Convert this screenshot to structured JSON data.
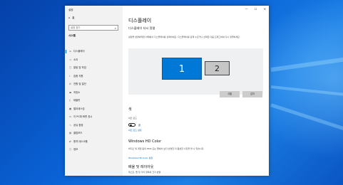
{
  "colors": {
    "accent": "#0078d7",
    "desktop": "#0a63d6",
    "link": "#0067b8"
  },
  "window": {
    "app_title": "설정",
    "controls": [
      "—",
      "☐",
      "✕"
    ],
    "home_label": "홈",
    "search_placeholder": "설정 찾기",
    "section": "시스템",
    "nav": [
      {
        "label": "디스플레이",
        "icon": "monitor-icon",
        "glyph": "▭",
        "active": true
      },
      {
        "label": "소리",
        "icon": "speaker-icon",
        "glyph": "◁"
      },
      {
        "label": "알림 및 작업",
        "icon": "notification-icon",
        "glyph": "▢"
      },
      {
        "label": "집중 지원",
        "icon": "moon-icon",
        "glyph": "☾"
      },
      {
        "label": "전원 및 절전",
        "icon": "power-icon",
        "glyph": "⏻"
      },
      {
        "label": "저장소",
        "icon": "storage-icon",
        "glyph": "▬"
      },
      {
        "label": "태블릿",
        "icon": "tablet-icon",
        "glyph": "▯"
      },
      {
        "label": "멀티태스킹",
        "icon": "multitask-icon",
        "glyph": "▦"
      },
      {
        "label": "이 PC에 화면 표시",
        "icon": "project-icon",
        "glyph": "▭"
      },
      {
        "label": "공유 환경",
        "icon": "share-icon",
        "glyph": "⤳"
      },
      {
        "label": "클립보드",
        "icon": "clipboard-icon",
        "glyph": "▤"
      },
      {
        "label": "원격 데스크톱",
        "icon": "remote-icon",
        "glyph": "⇄"
      },
      {
        "label": "정보",
        "icon": "info-icon",
        "glyph": "ⓘ"
      }
    ]
  },
  "content": {
    "title": "디스플레이",
    "subhead": "디스플레이 다시 정렬",
    "description": "설정을 변경하려면 아래에서 디스플레이를 선택하세요. 디스플레이를 길게 누르거나 선택한 다음 드래그하여 다시 정렬하세요.",
    "monitors": [
      "1",
      "2"
    ],
    "identify_button": "식별",
    "detect_button": "감지",
    "color_heading": "색",
    "night_light_label": "야간 모드",
    "night_light_state": "끔",
    "night_light_link": "야간 모드 설정",
    "hdr_heading": "Windows HD Color",
    "hdr_desc": "비디오 및 게임 등의 HDR 또는 앱에서 보다 선명한 더 풍성한 사진을 볼 수 있습니다.",
    "hdr_link": "Windows HD Color 설정",
    "scale_heading": "배율 및 레이아웃",
    "scale_desc": "텍스트, 앱 및 기타 항목의 크기 변경"
  }
}
